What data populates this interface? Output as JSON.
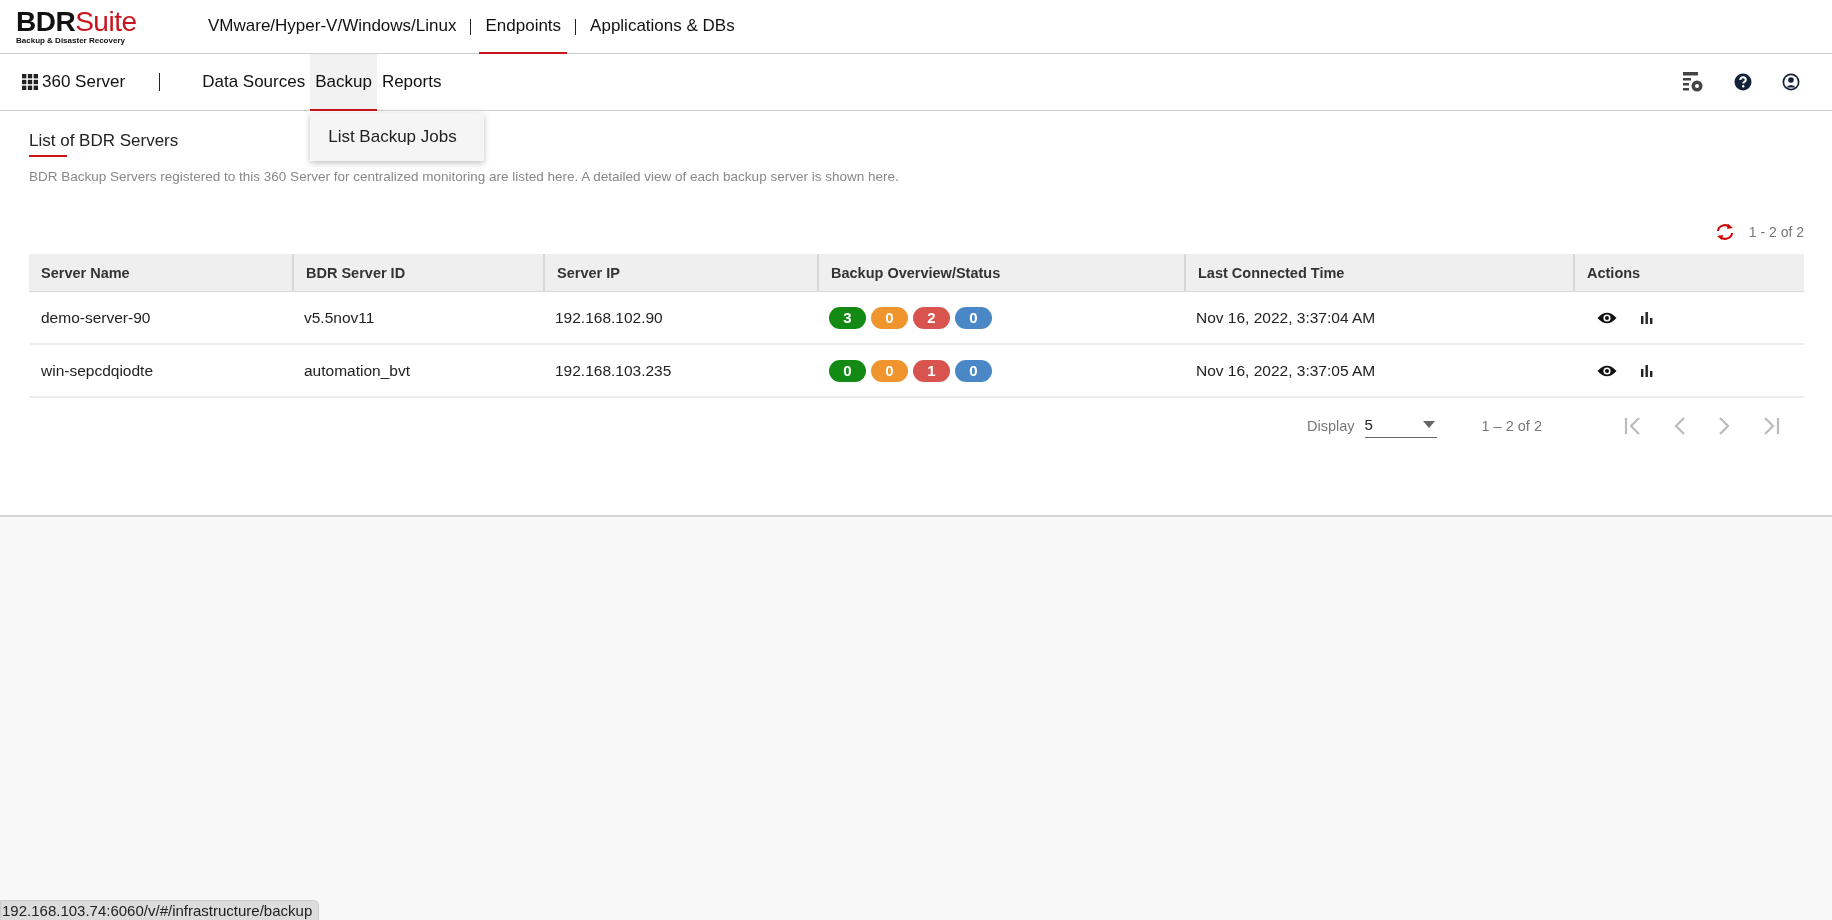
{
  "header": {
    "logo": {
      "brand": "BDR",
      "brand_accent": "Suite",
      "tagline": "Backup & Disaster Recovery"
    },
    "nav": [
      {
        "label": "VMware/Hyper-V/Windows/Linux",
        "selected": false
      },
      {
        "label": "Endpoints",
        "selected": true
      },
      {
        "label": "Applications & DBs",
        "selected": false
      }
    ]
  },
  "subnav": {
    "app": "360 Server",
    "items": [
      {
        "label": "Data Sources",
        "selected": false
      },
      {
        "label": "Backup",
        "selected": true
      },
      {
        "label": "Reports",
        "selected": false
      }
    ],
    "dropdown": {
      "items": [
        "List Backup Jobs"
      ]
    }
  },
  "page": {
    "title": "List of BDR Servers",
    "description": "BDR Backup Servers registered to this 360 Server for centralized monitoring are listed here. A detailed view of each backup server is shown here."
  },
  "table": {
    "range": "1 - 2 of 2",
    "columns": [
      "Server Name",
      "BDR Server ID",
      "Server IP",
      "Backup Overview/Status",
      "Last Connected Time",
      "Actions"
    ],
    "rows": [
      {
        "server_name": "demo-server-90",
        "server_id": "v5.5nov11",
        "server_ip": "192.168.102.90",
        "badges": [
          {
            "count": "3",
            "color": "#138a13"
          },
          {
            "count": "0",
            "color": "#f0952d"
          },
          {
            "count": "2",
            "color": "#d9534f"
          },
          {
            "count": "0",
            "color": "#4a87c6"
          }
        ],
        "last_connected": "Nov 16, 2022, 3:37:04 AM"
      },
      {
        "server_name": "win-sepcdqiodte",
        "server_id": "automation_bvt",
        "server_ip": "192.168.103.235",
        "badges": [
          {
            "count": "0",
            "color": "#138a13"
          },
          {
            "count": "0",
            "color": "#f0952d"
          },
          {
            "count": "1",
            "color": "#d9534f"
          },
          {
            "count": "0",
            "color": "#4a87c6"
          }
        ],
        "last_connected": "Nov 16, 2022, 3:37:05 AM"
      }
    ]
  },
  "pagination": {
    "display_label": "Display",
    "page_size": "5",
    "range": "1 – 2 of 2"
  },
  "status_url": "192.168.103.74:6060/v/#/infrastructure/backup"
}
